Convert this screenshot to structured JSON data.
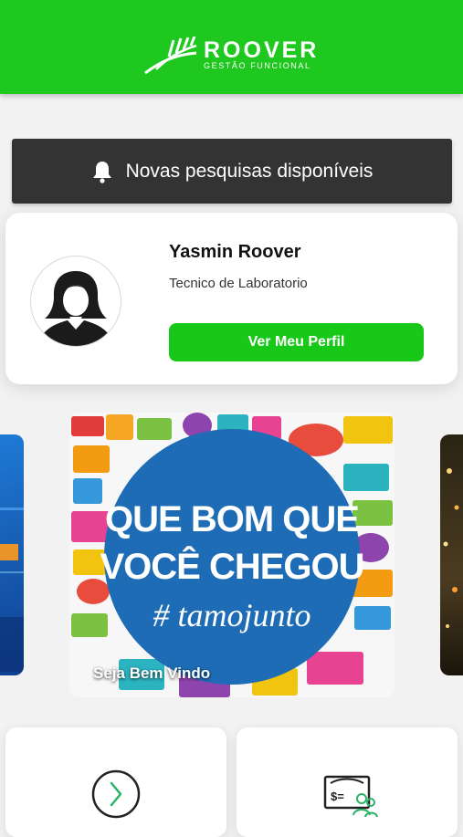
{
  "header": {
    "brand": "ROOVER",
    "tagline": "GESTÃO FUNCIONAL",
    "background_color": "#1ec81e"
  },
  "notice": {
    "icon": "bell-icon",
    "text": "Novas pesquisas disponíveis"
  },
  "profile": {
    "name": "Yasmin Roover",
    "role": "Tecnico de Laboratorio",
    "button_label": "Ver Meu Perfil",
    "avatar_icon": "user-avatar-icon"
  },
  "carousel": {
    "banner_lines": [
      "QUE BOM QUE",
      "VOCÊ CHEGOU"
    ],
    "banner_hashtag": "# tamojunto",
    "caption": "Seja Bem Vindo"
  },
  "shortcuts": [
    {
      "icon": "chevron-right-circle-icon"
    },
    {
      "icon": "payslip-people-icon"
    }
  ]
}
